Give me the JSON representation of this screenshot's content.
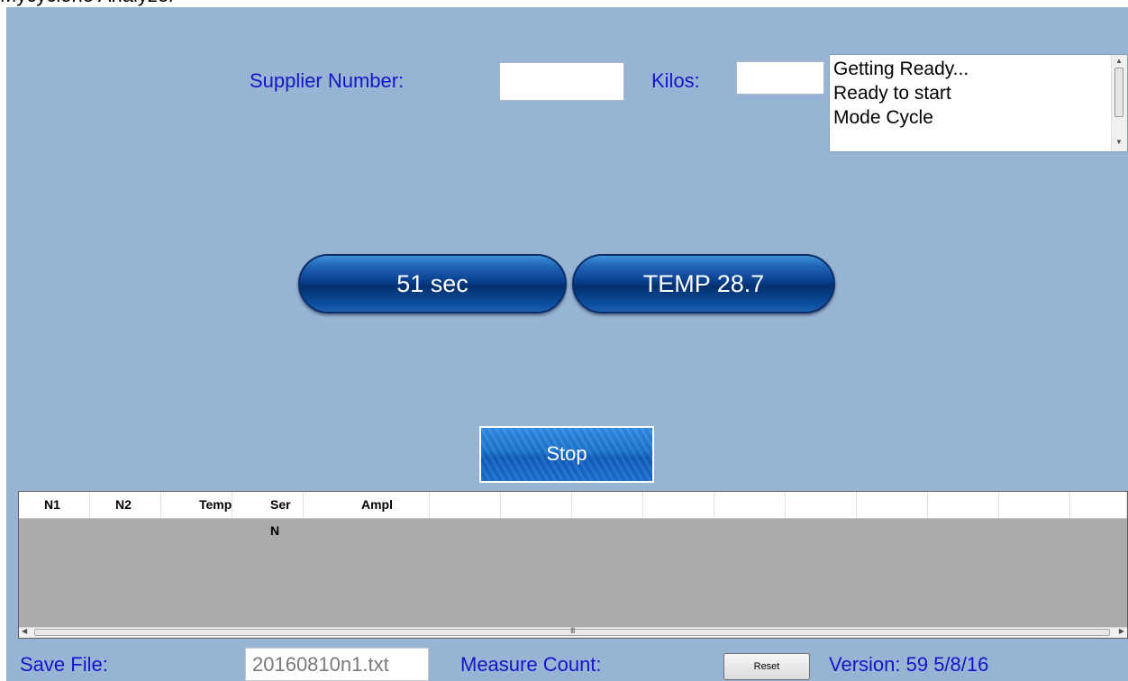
{
  "window": {
    "title": "Mycyclone Analyzer"
  },
  "form": {
    "supplier_label": "Supplier Number:",
    "supplier_value": "",
    "kilos_label": "Kilos:",
    "kilos_value": ""
  },
  "status_log": {
    "lines": [
      "Getting Ready...",
      "Ready to start",
      "Mode Cycle"
    ],
    "scroll_up": "▲",
    "scroll_down": "▼"
  },
  "indicators": {
    "timer": "51 sec",
    "temperature": "TEMP 28.7"
  },
  "stop_button": {
    "label": "Stop"
  },
  "grid": {
    "columns": [
      "N1",
      "N2",
      "Temp",
      "Ser N",
      "Ampl",
      "",
      "",
      "",
      "",
      "",
      "",
      "",
      "",
      "",
      "",
      ""
    ],
    "rows": [],
    "scroll_left": "◀",
    "scroll_right": "▶",
    "grip": "III"
  },
  "footer": {
    "save_file_label": "Save File:",
    "save_file_value": "20160810n1.txt",
    "measure_count_label": "Measure Count:",
    "reset_label": "Reset",
    "version_label": "Version: 59  5/8/16"
  },
  "colors": {
    "app_background": "#98b4d4",
    "label_text": "#1515c8",
    "indicator_pill": "#0a3f8f",
    "stop_button": "#1b74cf",
    "grid_empty": "#ababab"
  }
}
